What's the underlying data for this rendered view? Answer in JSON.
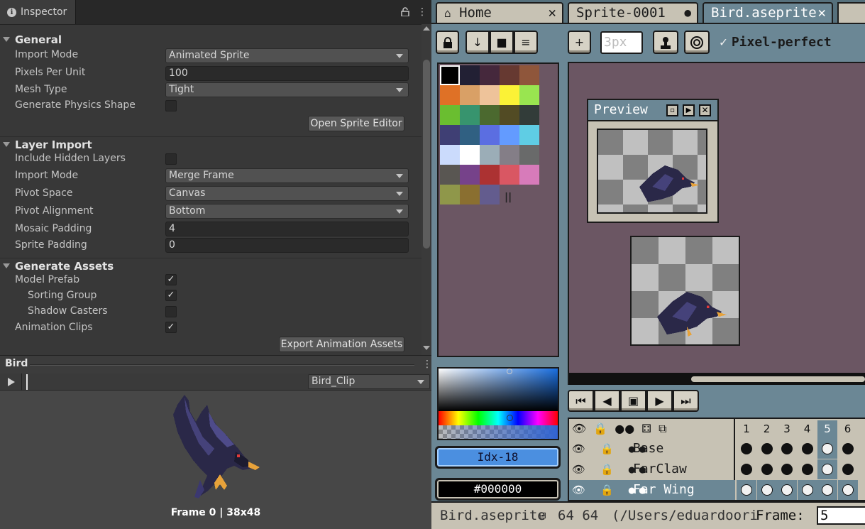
{
  "inspector": {
    "tab_title": "Inspector",
    "general": {
      "title": "General",
      "import_mode_label": "Import Mode",
      "import_mode_value": "Animated Sprite",
      "ppu_label": "Pixels Per Unit",
      "ppu_value": "100",
      "mesh_type_label": "Mesh Type",
      "mesh_type_value": "Tight",
      "physics_label": "Generate Physics Shape",
      "physics_checked": false,
      "open_editor": "Open Sprite Editor"
    },
    "layer_import": {
      "title": "Layer Import",
      "hidden_label": "Include Hidden Layers",
      "hidden_checked": false,
      "import_mode_label": "Import Mode",
      "import_mode_value": "Merge Frame",
      "pivot_space_label": "Pivot Space",
      "pivot_space_value": "Canvas",
      "pivot_alignment_label": "Pivot Alignment",
      "pivot_alignment_value": "Bottom",
      "mosaic_label": "Mosaic Padding",
      "mosaic_value": "4",
      "sprite_padding_label": "Sprite Padding",
      "sprite_padding_value": "0"
    },
    "generate_assets": {
      "title": "Generate Assets",
      "model_prefab_label": "Model Prefab",
      "sorting_group_label": "Sorting Group",
      "shadow_casters_label": "Shadow Casters",
      "animation_clips_label": "Animation Clips",
      "check_mark": "✓",
      "export_button": "Export Animation Assets"
    },
    "preview": {
      "title": "Bird",
      "clip": "Bird_Clip",
      "caption": "Frame 0 | 38x48"
    }
  },
  "aseprite": {
    "tabs": [
      {
        "label": "Home",
        "close": "✕"
      },
      {
        "label": "Sprite-0001",
        "close": "●"
      },
      {
        "label": "Bird.aseprite",
        "close": "✕"
      }
    ],
    "toolbar": {
      "brush_size": "3px",
      "pixel_perfect_label": "Pixel-perfect",
      "check": "✓"
    },
    "palette_colors": [
      "#000000",
      "#222034",
      "#45283c",
      "#663931",
      "#8f563b",
      "#df7126",
      "#d9a066",
      "#eec39a",
      "#fbf236",
      "#99e550",
      "#6abe30",
      "#37946e",
      "#4b692f",
      "#524b24",
      "#323c39",
      "#3f3f74",
      "#306082",
      "#5b6ee1",
      "#639bff",
      "#5fcde4",
      "#cbdbfc",
      "#ffffff",
      "#9badb7",
      "#847e87",
      "#696a6a",
      "#595652",
      "#76428a",
      "#ac3232",
      "#d95763",
      "#d77bba",
      "#8f974a",
      "#8a6f30",
      "#635c8e"
    ],
    "preview_title": "Preview",
    "color_index": "Idx-18",
    "color_hex": "#000000",
    "layers": [
      {
        "name": "Base"
      },
      {
        "name": "FarClaw"
      },
      {
        "name": "Far Wing"
      }
    ],
    "frames": [
      "1",
      "2",
      "3",
      "4",
      "5",
      "6"
    ],
    "status": {
      "filename": "Bird.aseprite",
      "size": "64 64",
      "path": "(/Users/eduardoori",
      "frame_label": "Frame:",
      "frame_value": "5"
    }
  }
}
